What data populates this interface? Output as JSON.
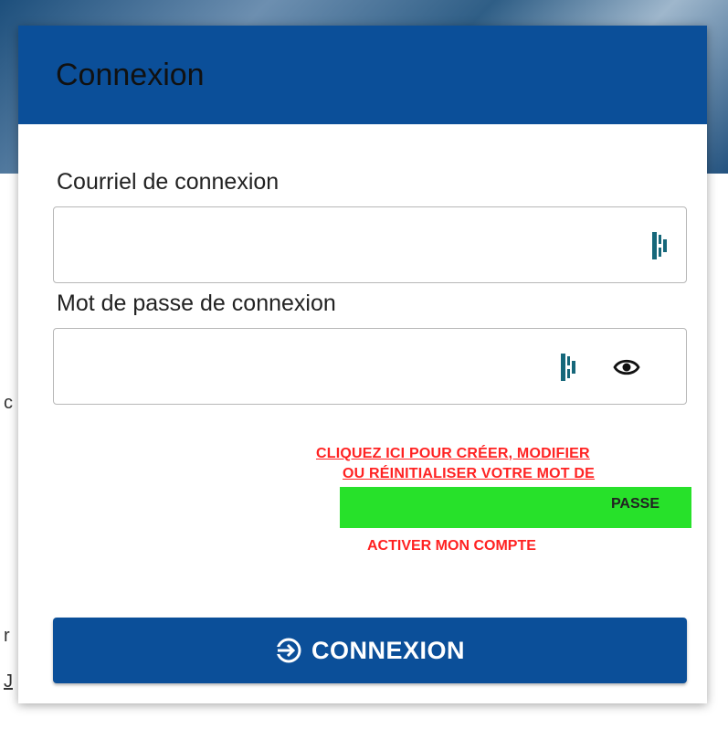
{
  "dialog": {
    "title": "Connexion",
    "email": {
      "label": "Courriel de connexion",
      "value": "",
      "placeholder": ""
    },
    "password": {
      "label": "Mot de passe de connexion",
      "value": "",
      "placeholder": ""
    },
    "links": {
      "reset_line1": "CLIQUEZ ICI POUR CRÉER, MODIFIER",
      "reset_line2": "OU RÉINITIALISER VOTRE MOT DE",
      "reset_line3": "PASSE",
      "activate": "ACTIVER MON COMPTE"
    },
    "submit_label": "CONNEXION"
  },
  "colors": {
    "primary": "#0b4f99",
    "link_red": "#ff2222",
    "highlight_green": "#27e12a"
  },
  "icons": {
    "password_manager": "password-manager-icon",
    "show_password": "eye-icon",
    "login": "login-icon"
  }
}
